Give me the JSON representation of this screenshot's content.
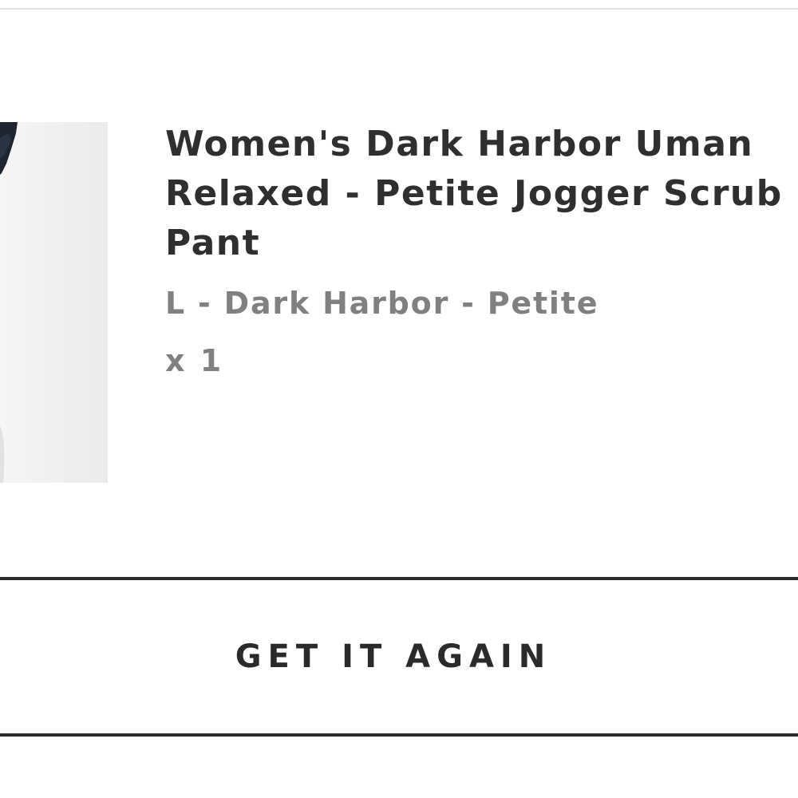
{
  "product": {
    "title": "Women's Dark Harbor Uman\nRelaxed - Petite Jogger Scrub\nPant",
    "variant": "L - Dark Harbor - Petite",
    "quantity": "x 1"
  },
  "actions": {
    "get_it_again_label": "GET IT AGAIN"
  }
}
